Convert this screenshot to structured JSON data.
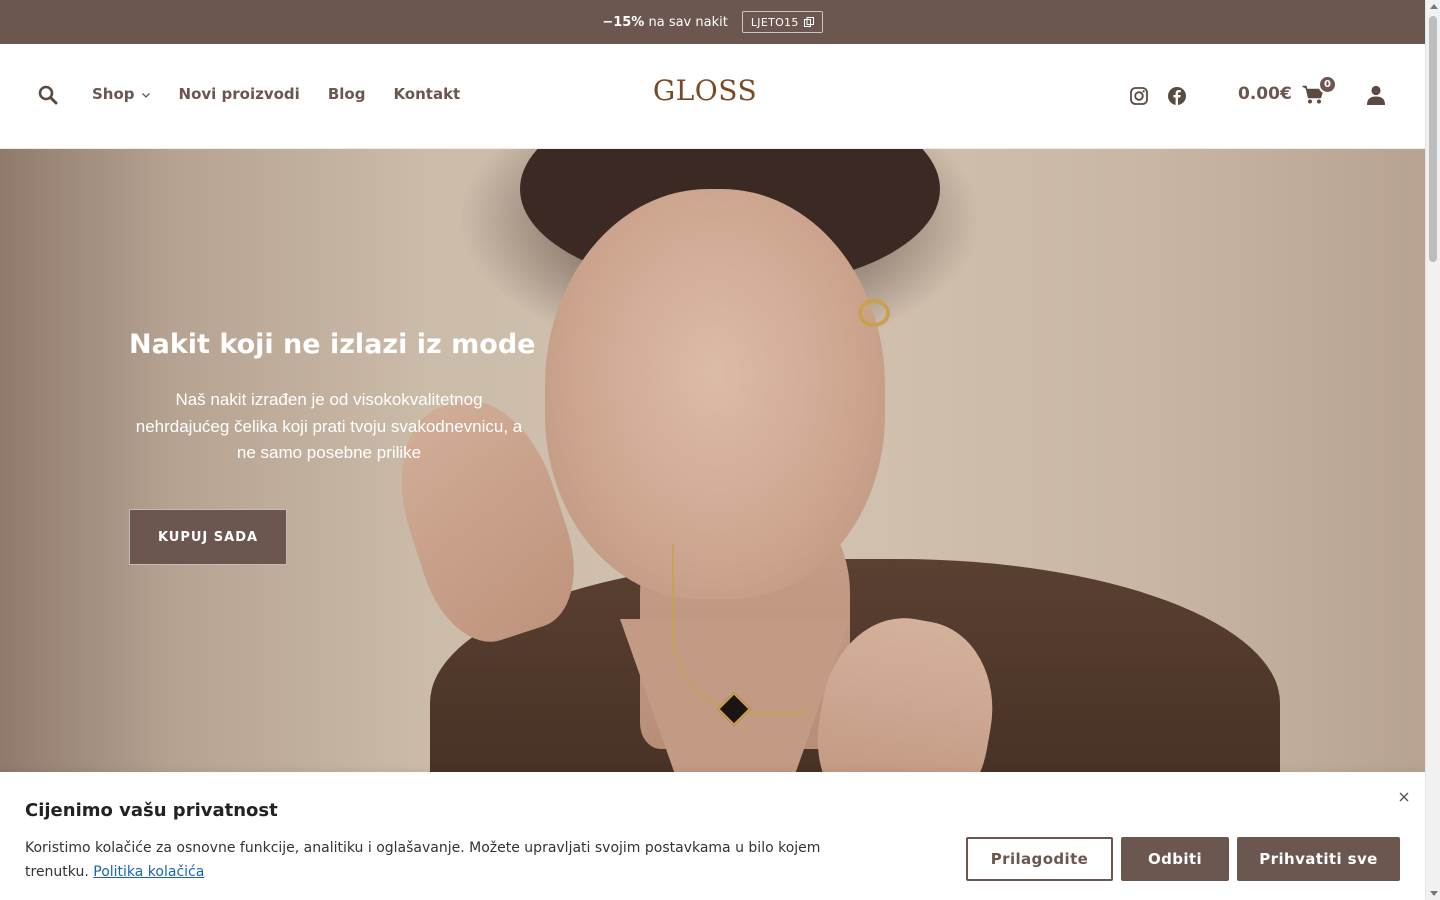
{
  "promo": {
    "discount": "−15%",
    "text": "na sav nakit",
    "coupon_code": "LJETO15",
    "coupon_icon": "copy-icon"
  },
  "header": {
    "logo": "GLOSS",
    "nav": [
      {
        "label": "Shop",
        "has_dropdown": true
      },
      {
        "label": "Novi proizvodi"
      },
      {
        "label": "Blog"
      },
      {
        "label": "Kontakt"
      }
    ],
    "icons": [
      "search-icon",
      "instagram-icon",
      "facebook-icon",
      "cart-icon",
      "user-icon"
    ],
    "cart_total": "0.00€",
    "cart_count": "0"
  },
  "hero": {
    "title": "Nakit koji ne izlazi iz mode",
    "subtitle": "Naš nakit izrađen je od visokokvalitetnog nehrdajućeg čelika koji prati tvoju svakodnevnicu, a ne samo posebne prilike",
    "cta": "KUPUJ SADA"
  },
  "cookie": {
    "title": "Cijenimo vašu privatnost",
    "text": "Koristimo kolačiće za osnovne funkcije, analitiku i oglašavanje. Možete upravljati svojim postavkama u bilo kojem trenutku.",
    "link": "Politika kolačića",
    "buttons": {
      "customize": "Prilagodite",
      "reject": "Odbiti",
      "accept": "Prihvatiti sve"
    }
  },
  "colors": {
    "brand": "#6b574f",
    "logo": "#7a4a22",
    "link": "#1a64b8"
  }
}
